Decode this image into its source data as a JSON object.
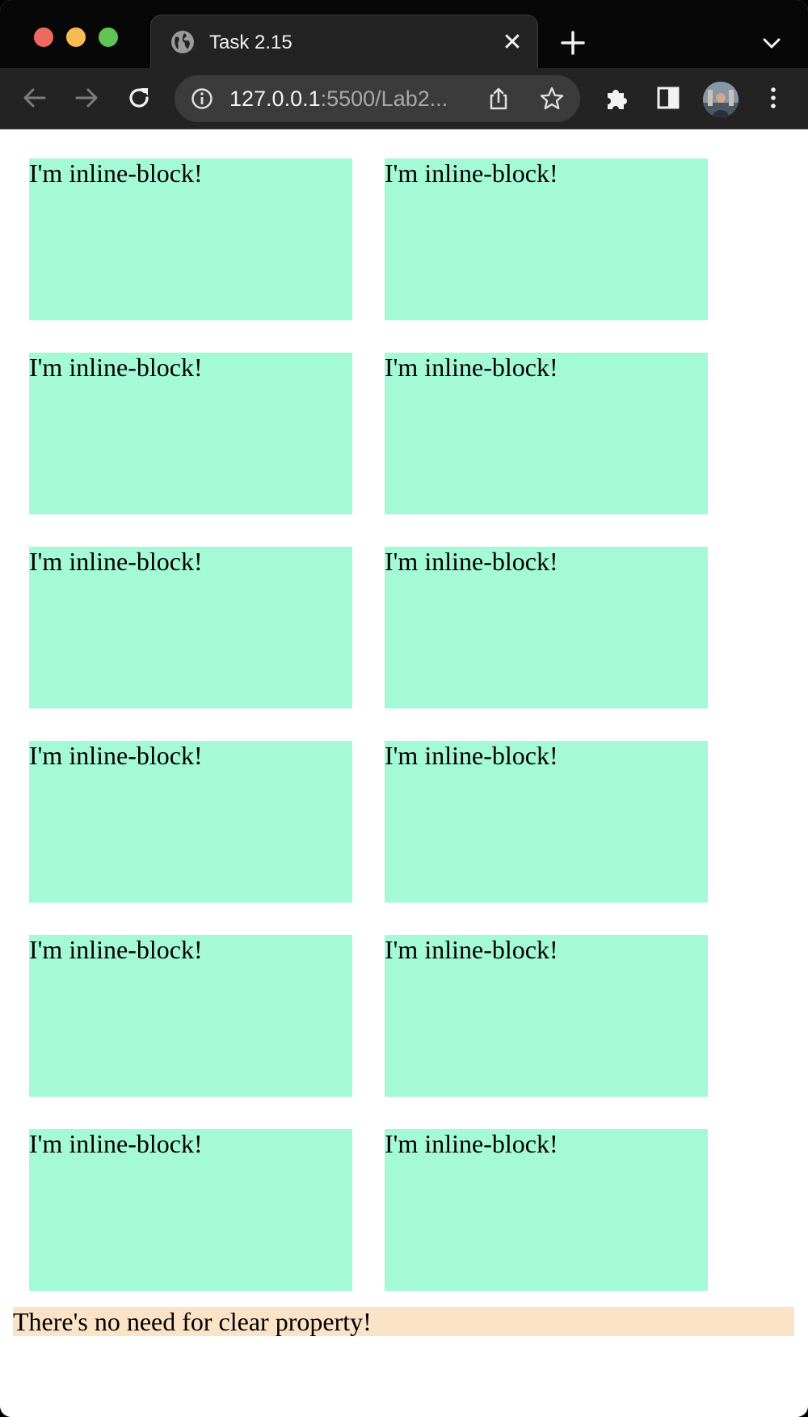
{
  "browser": {
    "tab_title": "Task 2.15",
    "tab_close_glyph": "✕",
    "url_host": "127.0.0.1",
    "url_rest": ":5500/Lab2...",
    "icons": [
      "globe-icon",
      "close-icon",
      "plus-icon",
      "chevron-down-icon",
      "back-arrow-icon",
      "forward-arrow-icon",
      "reload-icon",
      "info-icon",
      "share-icon",
      "star-icon",
      "puzzle-icon",
      "side-panel-icon",
      "avatar",
      "kebab-menu-icon"
    ]
  },
  "page": {
    "boxes": [
      "I'm inline-block!",
      "I'm inline-block!",
      "I'm inline-block!",
      "I'm inline-block!",
      "I'm inline-block!",
      "I'm inline-block!",
      "I'm inline-block!",
      "I'm inline-block!",
      "I'm inline-block!",
      "I'm inline-block!",
      "I'm inline-block!",
      "I'm inline-block!"
    ],
    "footer_text": "There's no need for clear property!",
    "box_color": "#a4f9d7",
    "footer_color": "#fbe3c7"
  }
}
